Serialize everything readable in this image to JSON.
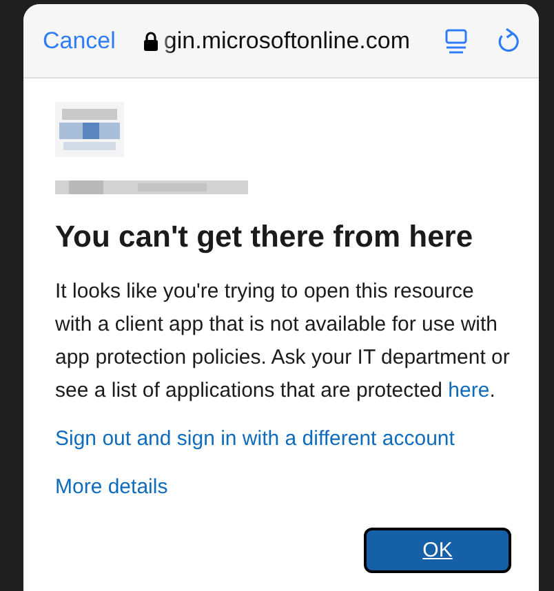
{
  "browser_bar": {
    "cancel": "Cancel",
    "url": "gin.microsoftonline.com",
    "secure": true
  },
  "title": "You can't get there from here",
  "message": {
    "text": "It looks like you're trying to open this resource with a client app that is not available for use with app protection policies. Ask your IT department or see a list of applications that are protected ",
    "link": "here",
    "end": "."
  },
  "links": [
    "Sign out and sign in with a different account",
    "More details"
  ],
  "button": "OK"
}
